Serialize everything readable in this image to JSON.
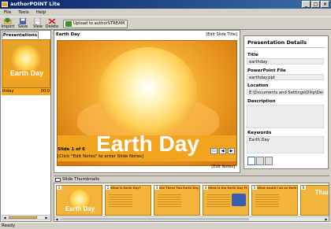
{
  "window": {
    "title": "authorPOINT Lite"
  },
  "menu": [
    "File",
    "Tools",
    "Help"
  ],
  "toolbar": {
    "import_label": "Import",
    "save_label": "Save",
    "view_label": "View",
    "delete_label": "Delete",
    "upload_label": "Upload to authorSTREAM"
  },
  "presentations": {
    "tab_label": "Presentations",
    "thumb_text": "Earth Day",
    "selected_name": "thday",
    "selected_duration": "00:0"
  },
  "slide": {
    "title": "Earth Day",
    "edit_title_label": "[Edit Slide Title]",
    "content_text": "Earth Day",
    "counter": "Slide 1 of 6",
    "notes_placeholder": "[Click \"Edit Notes\" to enter Slide Notes]",
    "edit_notes_label": "[Edit Notes]",
    "nav_first": "▭",
    "nav_prev": "◀",
    "nav_next": "▶"
  },
  "details": {
    "heading": "Presentation Details",
    "title_label": "Title",
    "title_value": "earthday",
    "ppt_label": "PowerPoint File",
    "ppt_value": "earthday.ppt",
    "location_label": "Location",
    "location_value": "E:\\Documents and Settings\\Dilip\\Desktop\\authorP",
    "description_label": "Description",
    "description_value": "",
    "keywords_label": "Keywords",
    "keywords_value": "Earth Day"
  },
  "thumbnails": {
    "bar_label": "Slide Thumbnails",
    "items": [
      {
        "num": "1",
        "title": "",
        "big_text": "Earth Day"
      },
      {
        "num": "2",
        "title": "What is Earth Day?",
        "big_text": ""
      },
      {
        "num": "3",
        "title": "Are There Two Earth Days?",
        "big_text": ""
      },
      {
        "num": "4",
        "title": "What is the Earth Day Flag?",
        "big_text": ""
      },
      {
        "num": "5",
        "title": "What would I do on Earth Day?",
        "big_text": ""
      },
      {
        "num": "6",
        "title": "",
        "big_text": "Thank"
      }
    ]
  },
  "status": {
    "text": "Ready"
  },
  "colors": {
    "accent": "#f4a71e",
    "titlebar": "#0a246a"
  }
}
